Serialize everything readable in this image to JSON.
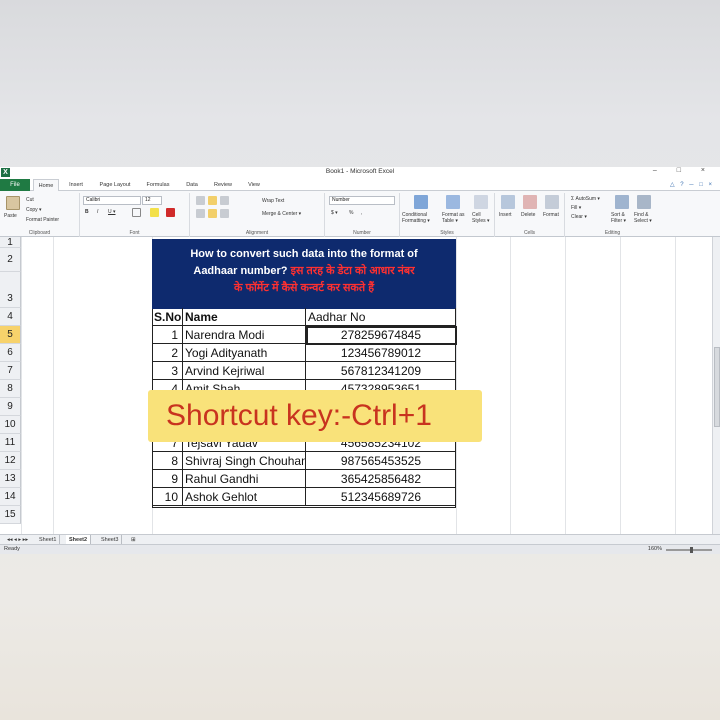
{
  "window": {
    "title": "Book1 - Microsoft Excel",
    "logo": "X",
    "controls": "– □ ×"
  },
  "ribbon_tabs": [
    "File",
    "Home",
    "Insert",
    "Page Layout",
    "Formulas",
    "Data",
    "Review",
    "View"
  ],
  "help_icons": "△ ? ─ □ ×",
  "ribbon": {
    "clipboard": {
      "label": "Clipboard",
      "paste": "Paste",
      "cut": "Cut",
      "copy": "Copy ▾",
      "format_painter": "Format Painter"
    },
    "font": {
      "label": "Font",
      "name": "Calibri",
      "size": "12",
      "bold": "B",
      "italic": "I",
      "underline": "U ▾"
    },
    "alignment": {
      "label": "Alignment",
      "wrap": "Wrap Text",
      "merge": "Merge & Center ▾"
    },
    "number": {
      "label": "Number",
      "format": "Number",
      "currency": "$ ▾",
      "percent": "%",
      "comma": ","
    },
    "styles": {
      "label": "Styles",
      "conditional": "Conditional Formatting ▾",
      "format_table": "Format as Table ▾",
      "cell_styles": "Cell Styles ▾"
    },
    "cells": {
      "label": "Cells",
      "insert": "Insert",
      "delete": "Delete",
      "format": "Format"
    },
    "editing": {
      "label": "Editing",
      "autosum": "Σ AutoSum ▾",
      "fill": "Fill ▾",
      "clear": "Clear ▾",
      "sort": "Sort & Filter ▾",
      "find": "Find & Select ▾"
    }
  },
  "row_numbers": [
    "1",
    "2",
    "3",
    "4",
    "5",
    "6",
    "7",
    "8",
    "9",
    "10",
    "11",
    "12",
    "13",
    "14",
    "15"
  ],
  "banner": {
    "line1": "How to convert such data into the format of",
    "line2_en": "Aadhaar number?",
    "line2_hi": " इस तरह के डेटा को आधार नंबर",
    "line3_hi": "के फॉर्मेट में कैसे कन्वर्ट कर सकते हैं"
  },
  "table": {
    "headers": [
      "S.No",
      "Name",
      "Aadhar No"
    ],
    "rows": [
      [
        "1",
        "Narendra Modi",
        "278259674845"
      ],
      [
        "2",
        "Yogi Adityanath",
        "123456789012"
      ],
      [
        "3",
        "Arvind Kejriwal",
        "567812341209"
      ],
      [
        "4",
        "Amit Shah",
        "457328953651"
      ],
      [
        "5",
        "",
        ""
      ],
      [
        "6",
        "",
        ""
      ],
      [
        "7",
        "Tejsavi Yadav",
        "456585234102"
      ],
      [
        "8",
        "Shivraj Singh Chouhan",
        "987565453525"
      ],
      [
        "9",
        "Rahul Gandhi",
        "365425856482"
      ],
      [
        "10",
        "Ashok Gehlot",
        "512345689726"
      ]
    ]
  },
  "sheets": [
    "Sheet1",
    "Sheet2",
    "Sheet3"
  ],
  "status": {
    "left": "Ready",
    "zoom": "160%"
  },
  "overlay": {
    "text": "Shortcut key:-Ctrl+1"
  },
  "colors": {
    "banner_bg": "#0e2a6e",
    "file_tab": "#1f7a43",
    "overlay_bg": "#f9e27a",
    "overlay_text": "#c8331f",
    "selected_row": "#f7d26b"
  }
}
